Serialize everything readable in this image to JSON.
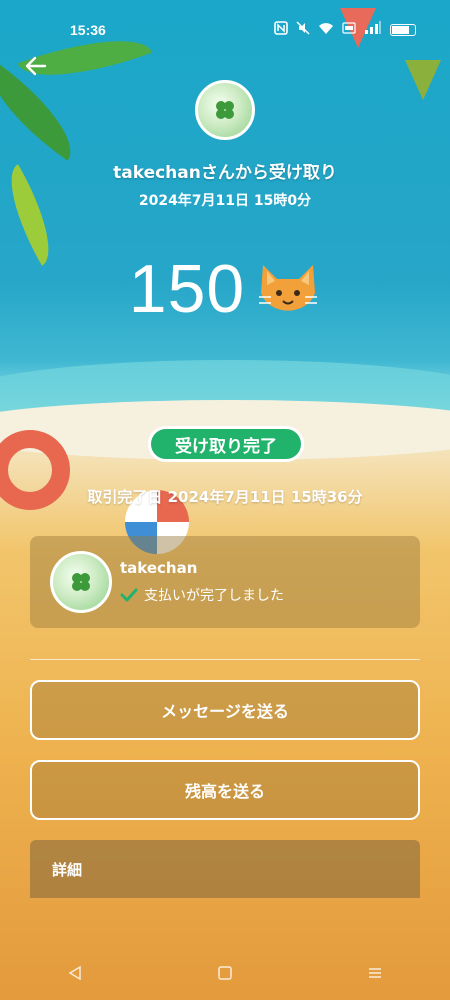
{
  "status_bar": {
    "time": "15:36",
    "icons": [
      "nfc-icon",
      "mute-icon",
      "wifi-icon",
      "volte-icon",
      "signal-icon",
      "battery-icon"
    ]
  },
  "header": {
    "sender_text": "takechanさんから受け取り",
    "datetime": "2024年7月11日 15時0分"
  },
  "amount": {
    "value": "150",
    "emoji": "cat-face"
  },
  "transaction": {
    "status_label": "受け取り完了",
    "completed_date": "取引完了日 2024年7月11日 15時36分"
  },
  "user_card": {
    "name": "takechan",
    "status": "支払いが完了しました",
    "status_color": "#21b36b"
  },
  "actions": {
    "message_label": "メッセージを送る",
    "balance_label": "残高を送る"
  },
  "details": {
    "label": "詳細"
  },
  "nav_bar": {
    "buttons": [
      "back-triangle-icon",
      "home-square-icon",
      "menu-lines-icon"
    ]
  },
  "colors": {
    "accent_green": "#21b36b",
    "sky": "#1aa7c9",
    "sand": "#eeb24f"
  }
}
